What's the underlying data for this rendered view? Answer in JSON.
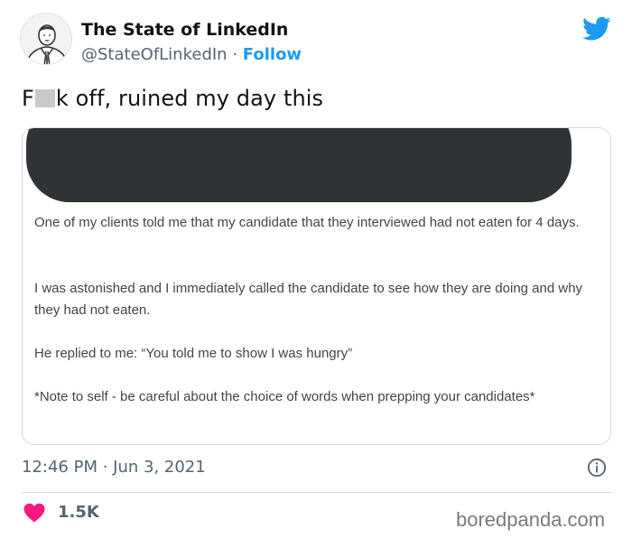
{
  "author": {
    "name": "The State of LinkedIn",
    "handle": "@StateOfLinkedIn",
    "separator": "·",
    "follow_label": "Follow"
  },
  "icons": {
    "brand": "twitter-bird-icon",
    "brand_color": "#1d9bf0",
    "info": "info-icon",
    "like": "heart-icon",
    "like_color": "#f91880"
  },
  "tweet": {
    "text_start": "F",
    "text_end": "k off, ruined my day this"
  },
  "card": {
    "paragraphs": [
      "One of my clients told me that my candidate that they interviewed had not eaten for 4 days.",
      "I was astonished and I immediately called the candidate to see how they are doing and why they had not eaten.",
      "He replied to me: “You told me to show I was hungry”",
      "*Note to self - be careful about the choice of words when prepping your candidates*"
    ]
  },
  "meta": {
    "timestamp": "12:46 PM · Jun 3, 2021",
    "likes": "1.5K"
  },
  "watermark": "boredpanda.com"
}
